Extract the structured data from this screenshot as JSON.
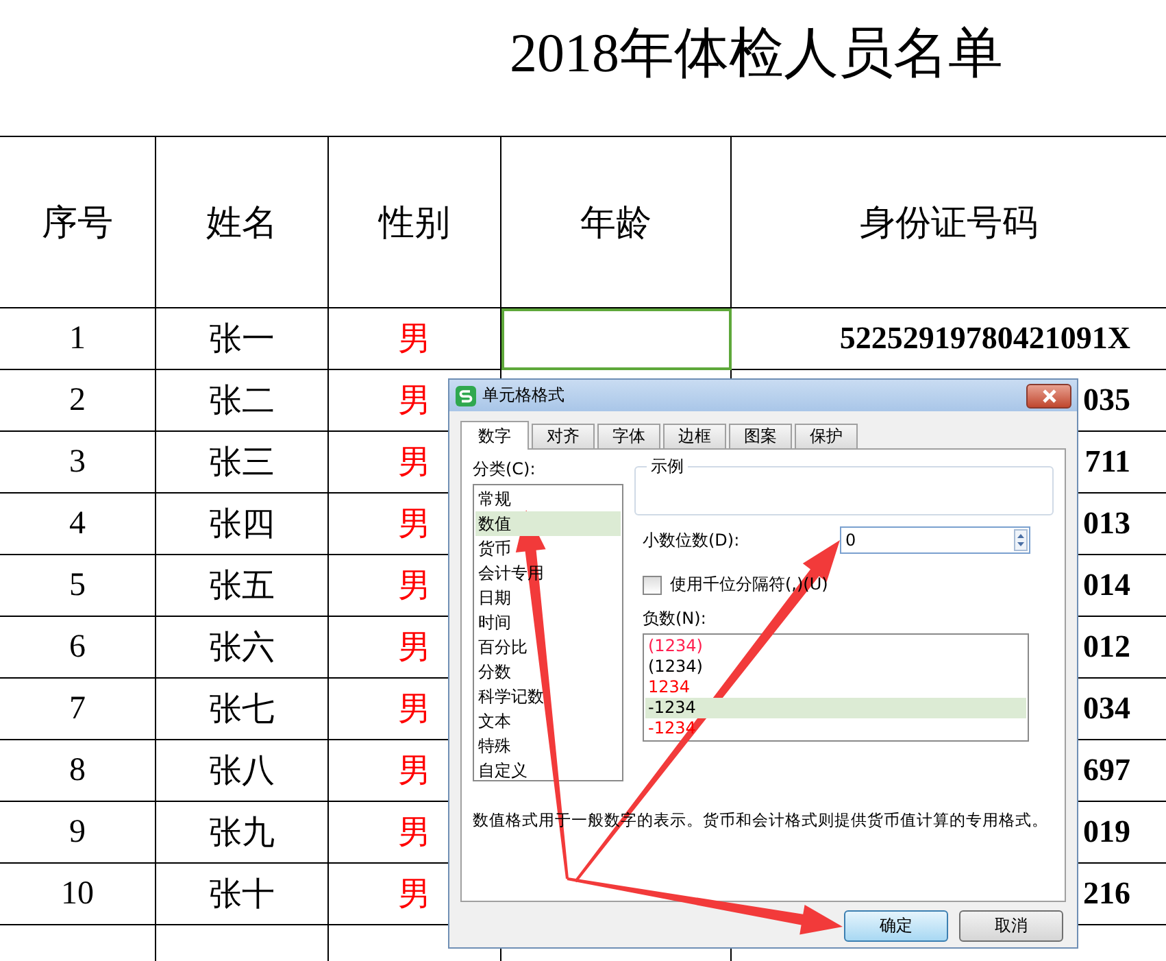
{
  "sheet": {
    "title": "2018年体检人员名单",
    "columns": [
      "序号",
      "姓名",
      "性别",
      "年龄",
      "身份证号码"
    ],
    "rows": [
      {
        "number": "1",
        "name": "张一",
        "gender": "男",
        "id_number": "52252919780421091X",
        "selected": true
      },
      {
        "number": "2",
        "name": "张二",
        "gender": "男",
        "id_number": "035"
      },
      {
        "number": "3",
        "name": "张三",
        "gender": "男",
        "id_number": "711"
      },
      {
        "number": "4",
        "name": "张四",
        "gender": "男",
        "id_number": "013"
      },
      {
        "number": "5",
        "name": "张五",
        "gender": "男",
        "id_number": "014"
      },
      {
        "number": "6",
        "name": "张六",
        "gender": "男",
        "id_number": "012"
      },
      {
        "number": "7",
        "name": "张七",
        "gender": "男",
        "id_number": "034"
      },
      {
        "number": "8",
        "name": "张八",
        "gender": "男",
        "id_number": "697"
      },
      {
        "number": "9",
        "name": "张九",
        "gender": "男",
        "id_number": "019"
      },
      {
        "number": "10",
        "name": "张十",
        "gender": "男",
        "id_number": "216"
      }
    ]
  },
  "dialog": {
    "title": "单元格格式",
    "tabs": [
      {
        "label": "数字",
        "selected": true
      },
      {
        "label": "对齐",
        "selected": false
      },
      {
        "label": "字体",
        "selected": false
      },
      {
        "label": "边框",
        "selected": false
      },
      {
        "label": "图案",
        "selected": false
      },
      {
        "label": "保护",
        "selected": false
      }
    ],
    "category_label": "分类(C):",
    "categories": [
      {
        "label": "常规",
        "selected": false
      },
      {
        "label": "数值",
        "selected": true
      },
      {
        "label": "货币",
        "selected": false
      },
      {
        "label": "会计专用",
        "selected": false
      },
      {
        "label": "日期",
        "selected": false
      },
      {
        "label": "时间",
        "selected": false
      },
      {
        "label": "百分比",
        "selected": false
      },
      {
        "label": "分数",
        "selected": false
      },
      {
        "label": "科学记数",
        "selected": false
      },
      {
        "label": "文本",
        "selected": false
      },
      {
        "label": "特殊",
        "selected": false
      },
      {
        "label": "自定义",
        "selected": false
      }
    ],
    "sample_label": "示例",
    "decimal_label": "小数位数(D):",
    "decimal_value": "0",
    "thousands": {
      "label": "使用千位分隔符(,)(U)",
      "checked": false
    },
    "negative_label": "负数(N):",
    "negative_formats": [
      {
        "text": "(1234)",
        "color": "#ff1f4f",
        "selected": false
      },
      {
        "text": "(1234)",
        "color": "#000000",
        "selected": false
      },
      {
        "text": "1234",
        "color": "#ff0000",
        "selected": false
      },
      {
        "text": "-1234",
        "color": "#000000",
        "selected": true
      },
      {
        "text": "-1234",
        "color": "#ff0000",
        "selected": false
      }
    ],
    "description": "数值格式用于一般数字的表示。货币和会计格式则提供货币值计算的专用格式。",
    "buttons": [
      {
        "label": "确定",
        "kind": "primary"
      },
      {
        "label": "取消",
        "kind": "secondary"
      }
    ]
  }
}
